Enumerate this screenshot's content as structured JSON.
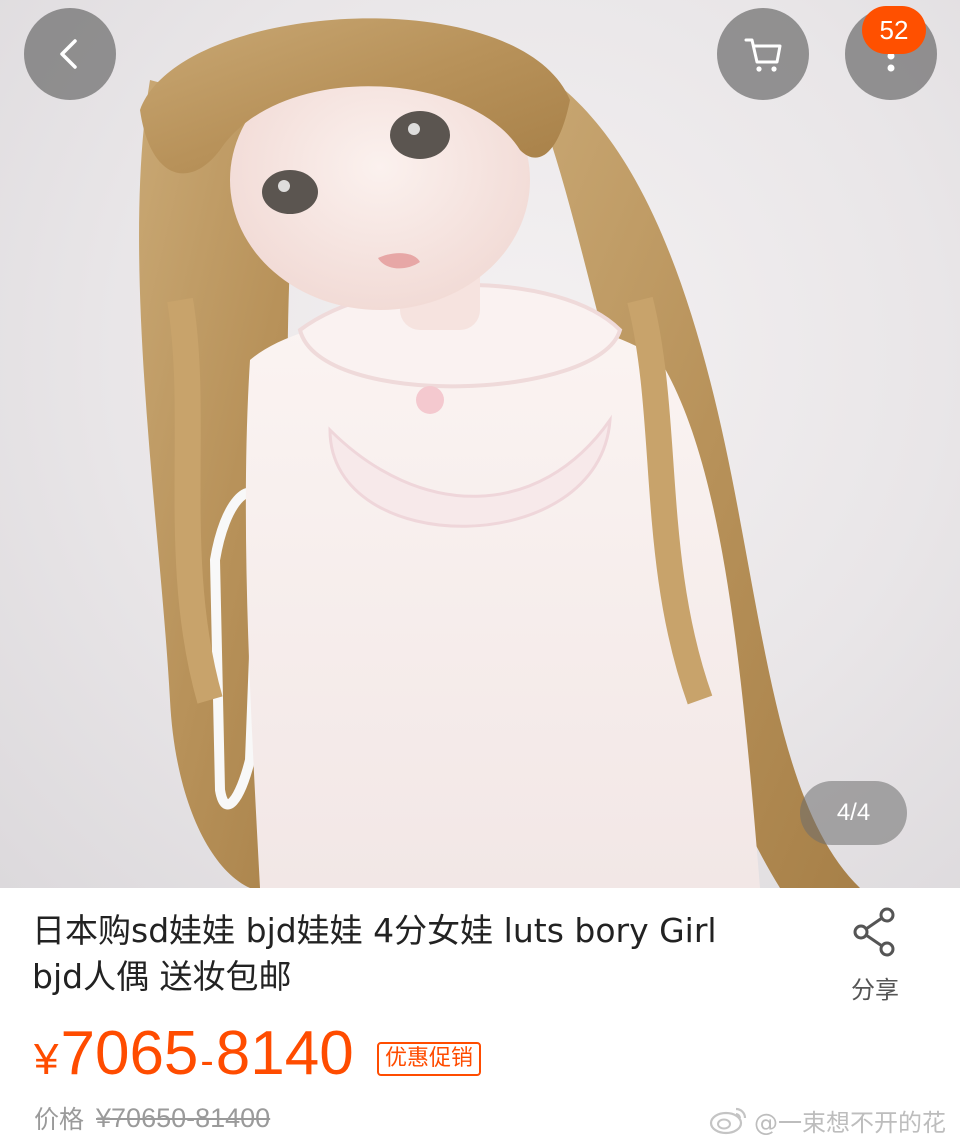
{
  "topbar": {
    "cart_badge_count": "52"
  },
  "gallery": {
    "page_indicator": "4/4"
  },
  "product": {
    "title": "日本购sd娃娃 bjd娃娃 4分女娃 luts bory Girl bjd人偶 送妆包邮",
    "share_label": "分享",
    "price_currency": "¥",
    "price_low": "7065",
    "price_separator": "-",
    "price_high": "8140",
    "promo_tag": "优惠促销",
    "original_price_label": "价格",
    "original_price": "¥70650-81400"
  },
  "watermark": {
    "text": "@一束想不开的花"
  },
  "colors": {
    "accent": "#ff5000",
    "price": "#ff4c00",
    "overlay_button": "#5a5a5a"
  },
  "icons": {
    "back": "chevron-left-icon",
    "cart": "cart-icon",
    "more": "more-vertical-icon",
    "share": "share-icon",
    "watermark": "weibo-icon"
  }
}
